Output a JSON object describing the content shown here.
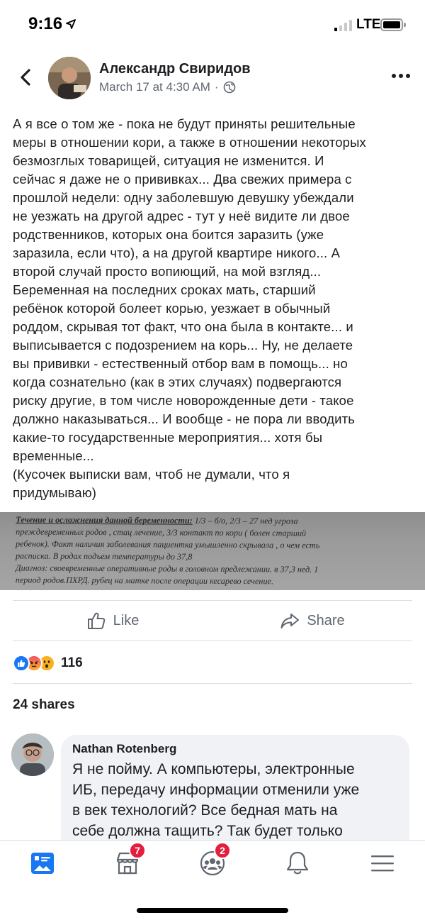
{
  "status_bar": {
    "time": "9:16",
    "network": "LTE",
    "location_icon": "location-arrow-icon",
    "signal_icon": "signal-bars-icon",
    "battery_icon": "battery-icon"
  },
  "header": {
    "back_icon": "chevron-left-icon",
    "author": "Александр Свиридов",
    "date": "March 17 at 4:30 AM",
    "separator": "·",
    "privacy_icon": "globe-icon",
    "more_icon": "more-horizontal-icon"
  },
  "post": {
    "text": "А я все о том же - пока не будут приняты решительные\nмеры в отношении кори, а также в отношении некоторых\nбезмозглых товарищей, ситуация не изменится. И\nсейчас я даже не о прививках... Два свежих примера с\nпрошлой недели: одну заболевшую девушку убеждали\nне уезжать на другой адрес - тут у неё видите ли двое\nродственников, которых она боится заразить (уже\nзаразила, если что), а на другой квартире никого... А\nвторой случай просто вопиющий, на мой взгляд...\nБеременная на последних сроках мать, старший\nребёнок которой болеет корью, уезжает в обычный\nроддом, скрывая тот факт, что она была в контакте... и\nвыписывается с подозрением на корь... Ну, не делаете\nвы прививки - естественный отбор вам в помощь... но\nкогда сознательно (как в этих случаях) подвергаются\nриску другие, в том числе новорожденные дети - такое\nдолжно наказываться... И вообще - не пора ли вводить\nкакие-то государственные мероприятия... хотя бы\nвременные...\n(Кусочек выписки вам, чтоб не думали, что я\nпридумываю)",
    "image": {
      "title": "Течение и осложнения данной беременности:",
      "body": " 1/3 – б/о, 2/3 – 27 нед угроза\nпреждевременных родов , стац лечение, 3/3  контакт по кори ( болен старший\nребенок). Факт наличия заболевания пациентка умышленно скрывала , о чем есть\nрасписка. В родах подъем температуры до 37,8\nДиагноз: своевременные оперативные роды в головном предлежании. в 37,3 нед. 1\nпериод родов.ПХРД. рубец на матке после операции кесарево сечение."
    }
  },
  "actions": {
    "like_label": "Like",
    "like_icon": "thumbs-up-icon",
    "share_label": "Share",
    "share_icon": "share-arrow-icon"
  },
  "reactions": {
    "count": "116",
    "icons": [
      "like-reaction-icon",
      "angry-reaction-icon",
      "wow-reaction-icon"
    ]
  },
  "shares": "24 shares",
  "comment": {
    "author": "Nathan Rotenberg",
    "text": "Я не пойму. А компьютеры, электронные\nИБ, передачу информации отменили уже\nв век технологий? Все бедная мать на\nсебе должна тащить? Так будет только"
  },
  "tabbar": {
    "tabs": [
      {
        "name": "news-feed-icon",
        "badge": ""
      },
      {
        "name": "marketplace-icon",
        "badge": "7"
      },
      {
        "name": "groups-icon",
        "badge": "2"
      },
      {
        "name": "notifications-bell-icon",
        "badge": ""
      },
      {
        "name": "menu-icon",
        "badge": ""
      }
    ]
  },
  "colors": {
    "accent": "#1877f2",
    "text": "#1c1e21",
    "secondary": "#606770",
    "badge": "#e41e3f"
  }
}
